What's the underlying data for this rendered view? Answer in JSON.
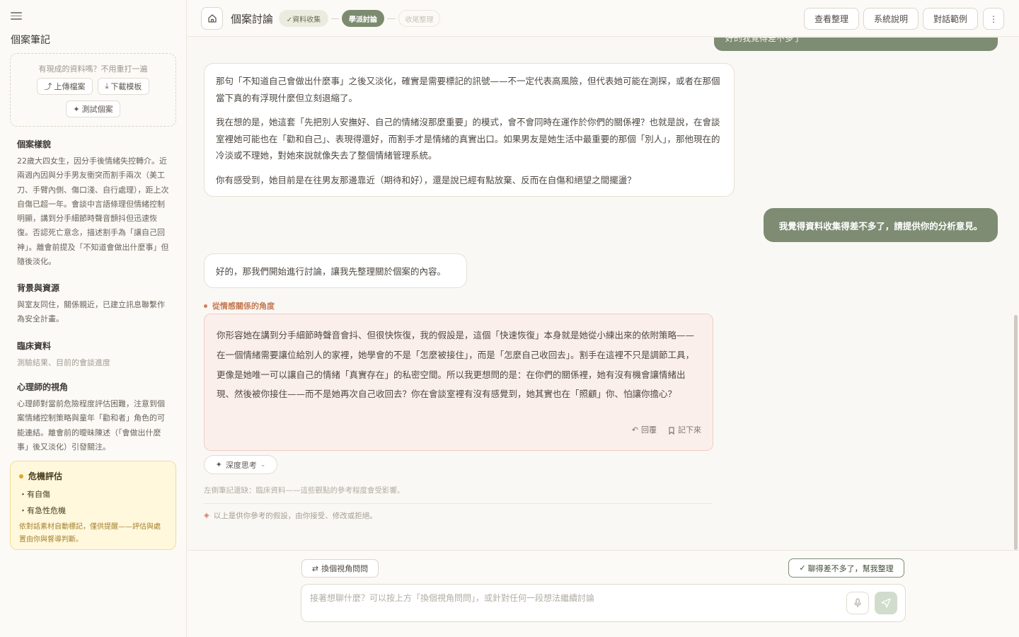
{
  "sidebar": {
    "title": "個案筆記",
    "upload_hint": "有現成的資料嗎？不用重打一遍",
    "upload_label": "上傳檔案",
    "download_label": "下載模板",
    "test_label": "測試個案",
    "sections": [
      {
        "heading": "個案樣貌",
        "body": "22歲大四女生，因分手後情緒失控轉介。近兩週內因與分手男友衝突而割手兩次（美工刀、手臂內側、傷口淺、自行處理），距上次自傷已超一年。會談中言語條理但情緒控制明顯，講到分手細節時聲音顫抖但迅速恢復。否認死亡意念，描述割手為「讓自己回神」。離會前提及「不知道會做出什麼事」但隨後淡化。"
      },
      {
        "heading": "背景與資源",
        "body": "與室友同住，關係親近，已建立訊息聯繫作為安全計畫。"
      },
      {
        "heading": "臨床資料",
        "body": "測驗結果、目前的會談進度"
      },
      {
        "heading": "心理師的視角",
        "body": "心理師對當前危險程度評估困難，注意到個案情緒控制策略與童年「勸和者」角色的可能連結。離會前的曖昧陳述（「會做出什麼事」後又淡化）引發關注。"
      }
    ],
    "crisis": {
      "heading": "危機評估",
      "items": [
        "有自傷",
        "有急性危機"
      ],
      "note": "依對話素材自動標記，僅供提醒——評估與處置由你與督導判斷。"
    }
  },
  "header": {
    "title": "個案討論",
    "steps": [
      "✓資料收集",
      "學派討論",
      "收尾整理"
    ],
    "buttons": [
      "查看整理",
      "系統說明",
      "對話範例"
    ],
    "more": "⋮"
  },
  "chat": {
    "prev_user_tail": "好的我覺得差不多了",
    "ai_message_1": [
      "那句「不知道自己會做出什麼事」之後又淡化，確實是需要標記的訊號——不一定代表高風險，但代表她可能在測探，或者在那個當下真的有浮現什麼但立刻退縮了。",
      "我在想的是，她這套「先把別人安撫好、自己的情緒沒那麼重要」的模式，會不會同時在運作於你們的關係裡？也就是說，在會談室裡她可能也在「勸和自己」、表現得還好，而割手才是情緒的真實出口。如果男友是她生活中最重要的那個「別人」，那他現在的冷淡或不理她，對她來說就像失去了整個情緒管理系統。",
      "你有感受到，她目前是在往男友那邊靠近（期待和好），還是說已經有點放棄、反而在自傷和絕望之間擺盪？"
    ],
    "user_message": "我覺得資料收集得差不多了，請提供你的分析意見。",
    "ai_message_2": "好的，那我們開始進行討論，讓我先整理關於個案的內容。",
    "perspective_label": "從情感關係的角度",
    "perspective_text": "你形容她在講到分手細節時聲音會抖、但很快恢復，我的假設是，這個「快速恢復」本身就是她從小練出來的依附策略——在一個情緒需要讓位給別人的家裡，她學會的不是「怎麼被接住」，而是「怎麼自己收回去」。割手在這裡不只是調節工具，更像是她唯一可以讓自己的情緒「真實存在」的私密空間。所以我更想問的是：在你們的關係裡，她有沒有機會讓情緒出現、然後被你接住——而不是她再次自己收回去？你在會談室裡有沒有感覺到，她其實也在「照顧」你、怕讓你擔心？",
    "reply_label": "回覆",
    "save_label": "記下來",
    "deep_think_label": "深度思考",
    "missing_note": "左側筆記還缺：臨床資料——這些觀點的參考程度會受影響。",
    "disclaimer": "以上是供你參考的假設，由你接受、修改或拒絕。"
  },
  "composer": {
    "switch_label": "換個視角問問",
    "summarize_label": "聊得差不多了，幫我整理",
    "placeholder": "接著想聊什麼？可以按上方「換個視角問問」，或針對任何一段想法繼續討論"
  },
  "colors": {
    "accent_green": "#7d8c72",
    "crisis_bg": "#fff8dc",
    "perspective_bg": "#fbefec",
    "perspective_accent": "#d87c55"
  },
  "icons": [
    "menu-icon",
    "home-icon",
    "upload-icon",
    "download-icon",
    "sparkle-icon",
    "reply-icon",
    "bookmark-icon",
    "chevron-down-icon",
    "swap-icon",
    "check-icon",
    "mic-icon",
    "send-icon",
    "diamond-icon"
  ]
}
